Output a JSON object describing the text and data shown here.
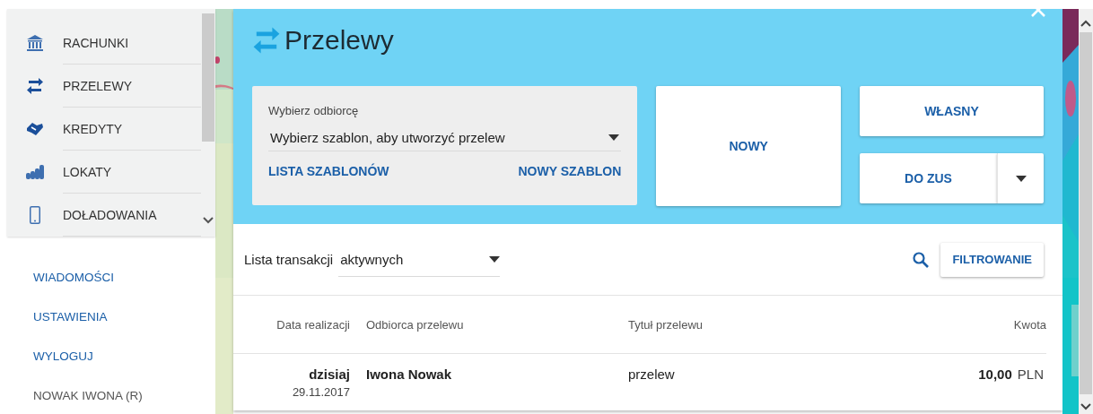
{
  "sidebar": {
    "menu": [
      {
        "label": "RACHUNKI"
      },
      {
        "label": "PRZELEWY"
      },
      {
        "label": "KREDYTY"
      },
      {
        "label": "LOKATY"
      },
      {
        "label": "DOŁADOWANIA"
      }
    ],
    "links": [
      {
        "label": "WIADOMOŚCI",
        "kind": "link"
      },
      {
        "label": "USTAWIENIA",
        "kind": "link"
      },
      {
        "label": "WYLOGUJ",
        "kind": "link"
      },
      {
        "label": "NOWAK IWONA (R)",
        "kind": "user"
      }
    ]
  },
  "dialog": {
    "title": "Przelewy",
    "recipient": {
      "label": "Wybierz odbiorcę",
      "value": "Wybierz szablon, aby utworzyć przelew",
      "actions": [
        "LISTA SZABLONÓW",
        "NOWY SZABLON"
      ]
    },
    "buttons": {
      "new": "NOWY",
      "own": "WŁASNY",
      "zus": "DO ZUS"
    },
    "list": {
      "label": "Lista transakcji",
      "filter": "aktywnych",
      "filter_button": "FILTROWANIE"
    },
    "table": {
      "columns": [
        "Data realizacji",
        "Odbiorca przelewu",
        "Tytuł przelewu",
        "Kwota"
      ],
      "rows": [
        {
          "day": "dzisiaj",
          "date": "29.11.2017",
          "recipient": "Iwona Nowak",
          "title": "przelew",
          "amount": "10,00",
          "currency": "PLN"
        }
      ]
    }
  }
}
